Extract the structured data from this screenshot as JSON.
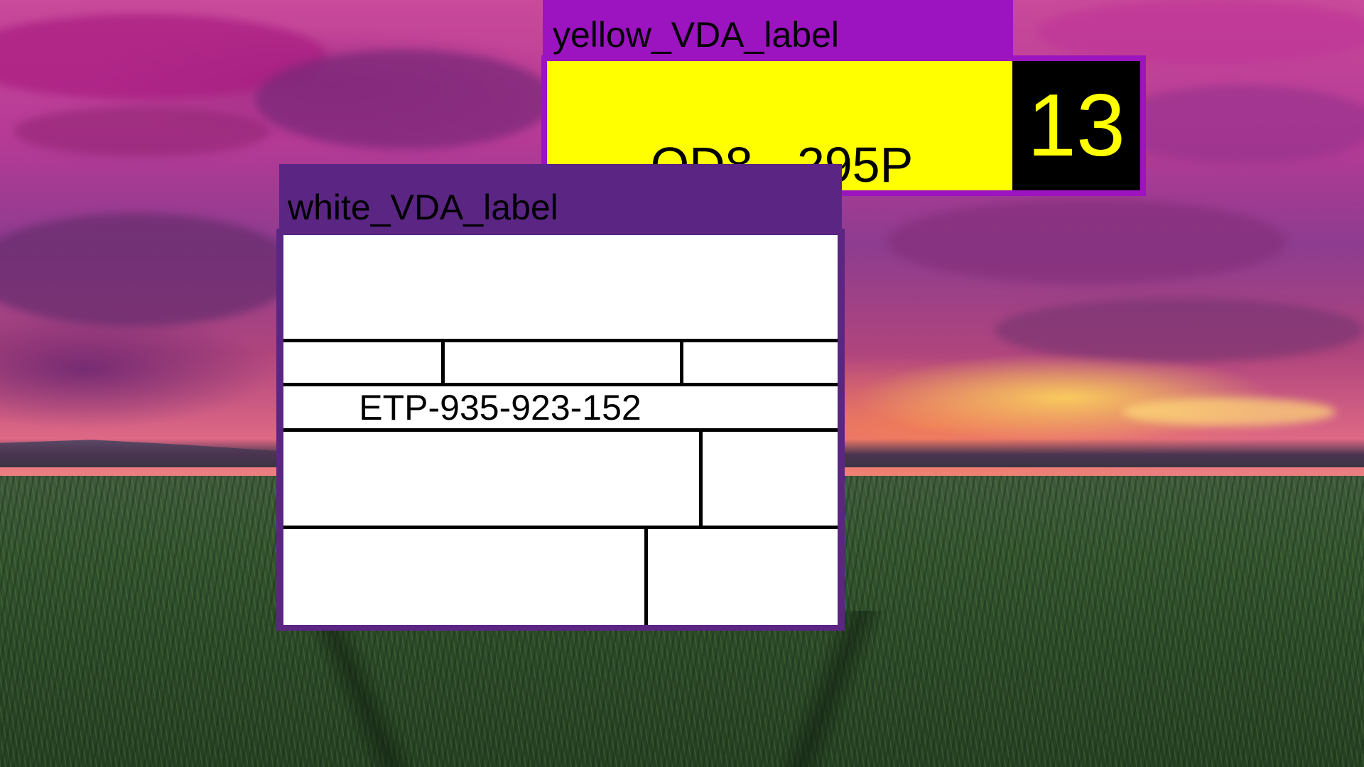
{
  "background": {
    "sky": "sunset-magenta",
    "ground": "green-field"
  },
  "yellow_window": {
    "title": "yellow_VDA_label",
    "code": "OD8 - 295P",
    "number": "13",
    "colors": {
      "frame": "#9b14bf",
      "label": "#ffff00",
      "number_box": "#000000",
      "number_text": "#ffff00"
    }
  },
  "white_window": {
    "title": "white_VDA_label",
    "code": "ETP-935-923-152",
    "colors": {
      "frame": "#5a2583",
      "label": "#ffffff",
      "lines": "#000000"
    }
  }
}
